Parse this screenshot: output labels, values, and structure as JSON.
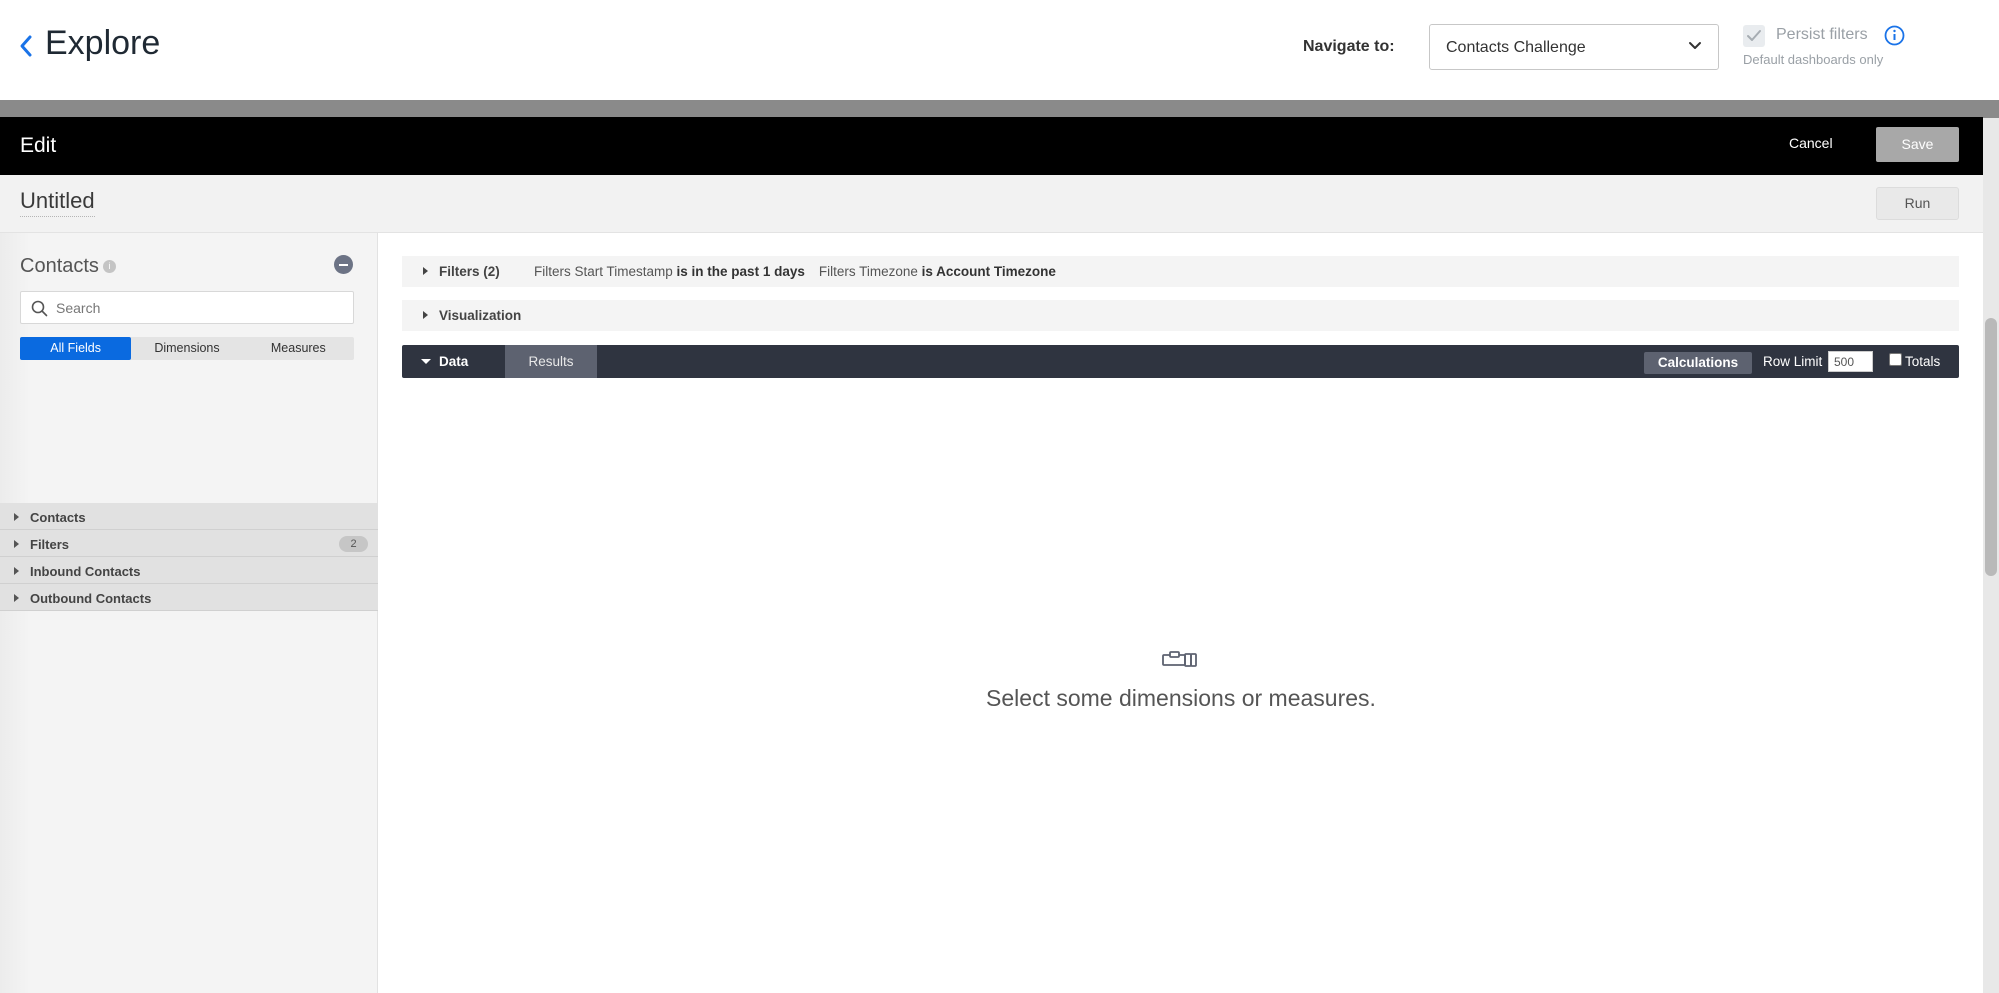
{
  "header": {
    "back_icon": "chevron-left-icon",
    "title": "Explore",
    "navigate_label": "Navigate to:",
    "navigate_value": "Contacts Challenge",
    "persist_label": "Persist filters",
    "persist_checked": true,
    "persist_subtext": "Default dashboards only",
    "accent_color": "#1a73e8"
  },
  "modal": {
    "title": "Edit",
    "cancel_label": "Cancel",
    "save_label": "Save",
    "query_title": "Untitled",
    "run_label": "Run"
  },
  "sidebar": {
    "explore_name": "Contacts",
    "search_placeholder": "Search",
    "tabs": [
      {
        "label": "All Fields",
        "active": true
      },
      {
        "label": "Dimensions",
        "active": false
      },
      {
        "label": "Measures",
        "active": false
      }
    ],
    "groups": [
      {
        "label": "Contacts",
        "badge": ""
      },
      {
        "label": "Filters",
        "badge": "2"
      },
      {
        "label": "Inbound Contacts",
        "badge": ""
      },
      {
        "label": "Outbound Contacts",
        "badge": ""
      }
    ],
    "active_tab_color": "#0a6ae0"
  },
  "main": {
    "filters_title": "Filters (2)",
    "filter1_field": "Filters Start Timestamp",
    "filter1_condition": "is in the past 1 days",
    "filter2_field": "Filters Timezone",
    "filter2_condition": "is Account Timezone",
    "visualization_title": "Visualization",
    "data_tab_label": "Data",
    "results_tab_label": "Results",
    "calculations_label": "Calculations",
    "row_limit_label": "Row Limit",
    "row_limit_value": "500",
    "totals_label": "Totals",
    "totals_checked": false,
    "empty_message": "Select some dimensions or measures."
  }
}
